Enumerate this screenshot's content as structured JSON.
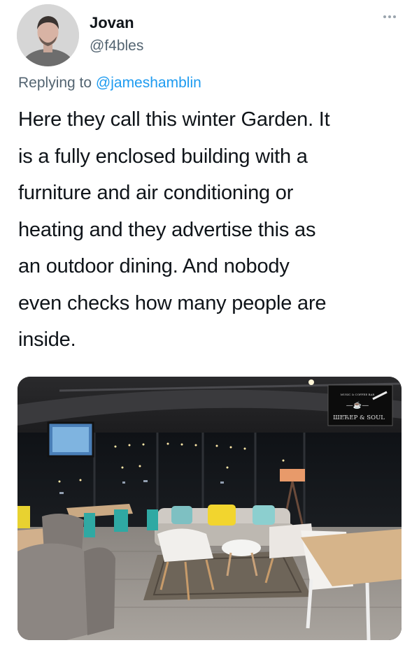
{
  "author": {
    "display_name": "Jovan",
    "handle": "@f4bles",
    "avatar_icon": "user-avatar"
  },
  "reply": {
    "prefix": "Replying to",
    "mention": "@jameshamblin"
  },
  "tweet": {
    "lines": [
      "Here they call this winter Garden. It",
      "is a fully enclosed building with a",
      "furniture and air conditioning or",
      "heating and they advertise this as",
      "an outdoor dining. And nobody",
      "even checks how many people are",
      "inside."
    ]
  },
  "media": {
    "logo_text": "ШЕЋЕР & SOUL",
    "logo_small_text": "MUSIC & COFFEE BAR"
  },
  "icons": {
    "more": "more-icon"
  }
}
